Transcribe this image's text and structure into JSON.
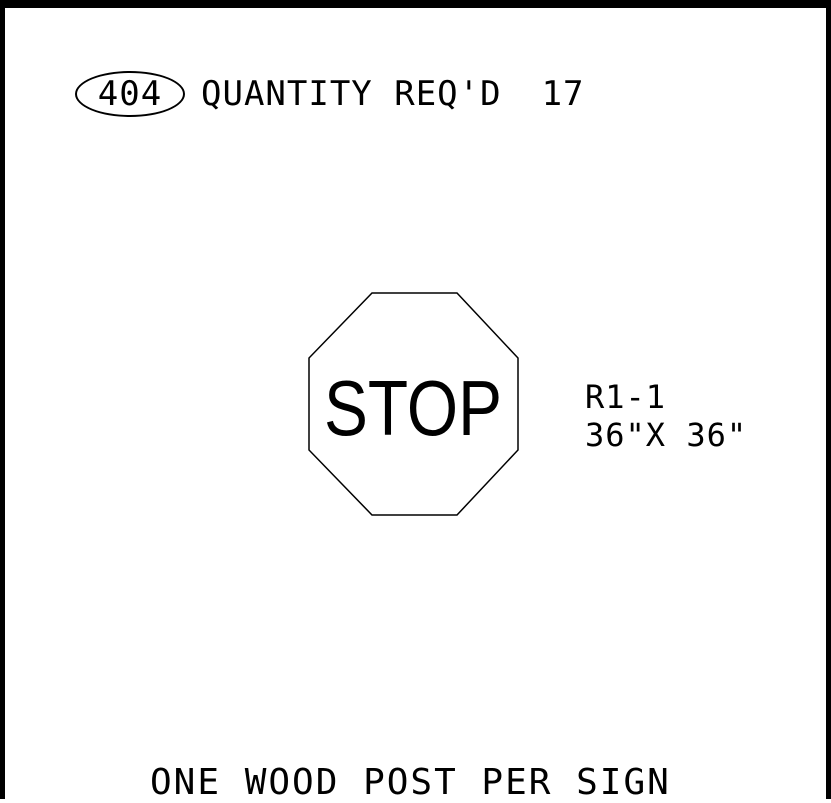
{
  "header": {
    "sign_id": "404",
    "quantity_label": "QUANTITY REQ'D",
    "quantity_value": "17"
  },
  "sign": {
    "legend": "STOP",
    "code": "R1-1",
    "size": "36\"X 36\""
  },
  "footer": {
    "note": "ONE WOOD POST PER SIGN"
  }
}
